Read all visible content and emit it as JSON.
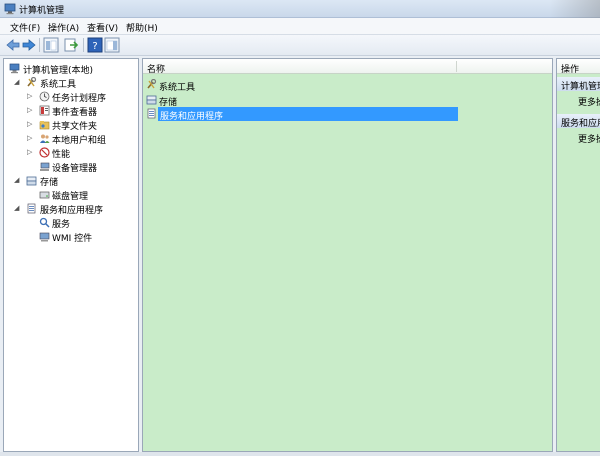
{
  "window": {
    "title": "计算机管理"
  },
  "menu": [
    "文件(F)",
    "操作(A)",
    "查看(V)",
    "帮助(H)"
  ],
  "toolbar": [
    "back-icon",
    "forward-icon",
    "console-tree-icon",
    "export-icon",
    "help-icon",
    "show-hide-pane-icon"
  ],
  "tree": {
    "items": [
      {
        "label": "计算机管理(本地)",
        "icon": "computer-management-icon"
      },
      {
        "label": "系统工具",
        "icon": "system-tools-icon"
      },
      {
        "label": "任务计划程序",
        "icon": "task-scheduler-icon"
      },
      {
        "label": "事件查看器",
        "icon": "event-viewer-icon"
      },
      {
        "label": "共享文件夹",
        "icon": "shared-folders-icon"
      },
      {
        "label": "本地用户和组",
        "icon": "local-users-icon"
      },
      {
        "label": "性能",
        "icon": "performance-icon"
      },
      {
        "label": "设备管理器",
        "icon": "device-manager-icon"
      },
      {
        "label": "存储",
        "icon": "storage-icon"
      },
      {
        "label": "磁盘管理",
        "icon": "disk-management-icon"
      },
      {
        "label": "服务和应用程序",
        "icon": "services-apps-icon"
      },
      {
        "label": "服务",
        "icon": "services-icon"
      },
      {
        "label": "WMI 控件",
        "icon": "wmi-control-icon"
      }
    ]
  },
  "list": {
    "header": "名称",
    "rows": [
      {
        "label": "系统工具",
        "icon": "system-tools-icon"
      },
      {
        "label": "存储",
        "icon": "storage-icon"
      },
      {
        "label": "服务和应用程序",
        "icon": "services-apps-icon",
        "selected": true
      }
    ]
  },
  "actions": {
    "header": "操作",
    "sections": [
      {
        "title": "计算机管理",
        "link": "更多操"
      },
      {
        "title": "服务和应用",
        "link": "更多操"
      }
    ]
  },
  "colors": {
    "content_bg": "#c9ecc9",
    "selection": "#3399ff"
  }
}
